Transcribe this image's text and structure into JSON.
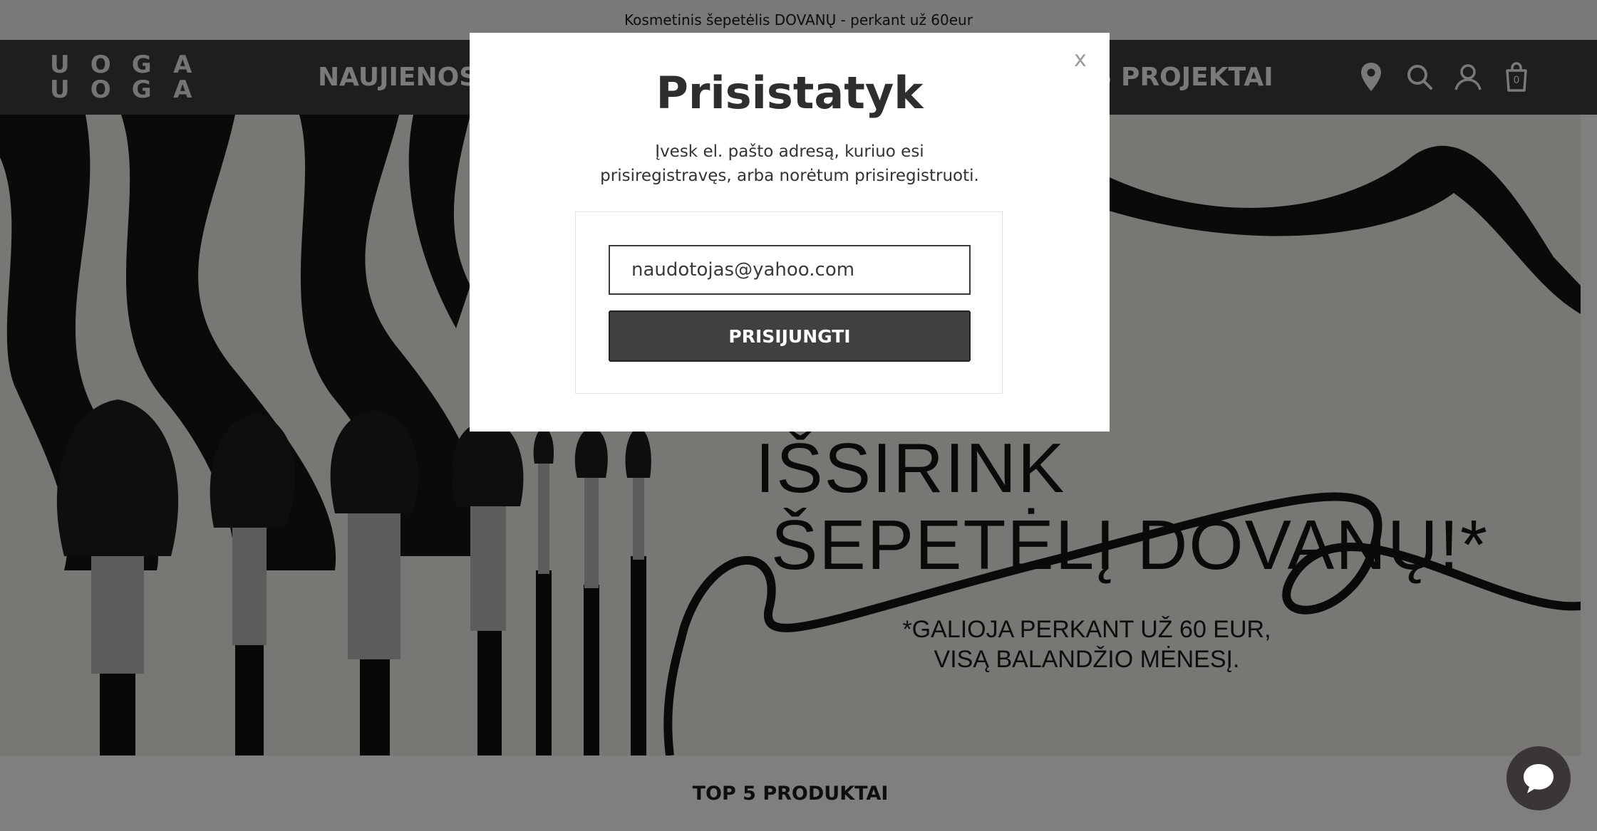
{
  "announcement": {
    "text": "Kosmetinis šepetėlis DOVANŲ - perkant už 60eur"
  },
  "logo": {
    "letters": [
      "U",
      "O",
      "G",
      "A",
      "U",
      "O",
      "G",
      "A"
    ]
  },
  "nav": {
    "links": [
      "NAUJIENOS!",
      "ES PROJEKTAI"
    ],
    "icons": [
      "location-pin-icon",
      "search-icon",
      "user-icon",
      "cart-icon"
    ],
    "cart_count": "0"
  },
  "hero": {
    "line1": "IŠSIRINK",
    "line2": "ŠEPETĖLĮ DOVANŲ!*",
    "note": "*GALIOJA PERKANT UŽ 60 EUR, VISĄ BALANDŽIO MĖNESĮ."
  },
  "section": {
    "title": "TOP 5 PRODUKTAI"
  },
  "modal": {
    "close_label": "x",
    "title": "Prisistatyk",
    "description": "Įvesk el. pašto adresą, kuriuo esi prisiregistravęs, arba norėtum prisiregistruoti.",
    "email_value": "naudotojas@yahoo.com",
    "submit_label": "PRISIJUNGTI"
  },
  "colors": {
    "nav_bg": "#3f3d3e",
    "button_bg": "#413f40",
    "overlay": "rgba(0,0,0,0.5)",
    "hero_bg": "#f2efe8"
  }
}
